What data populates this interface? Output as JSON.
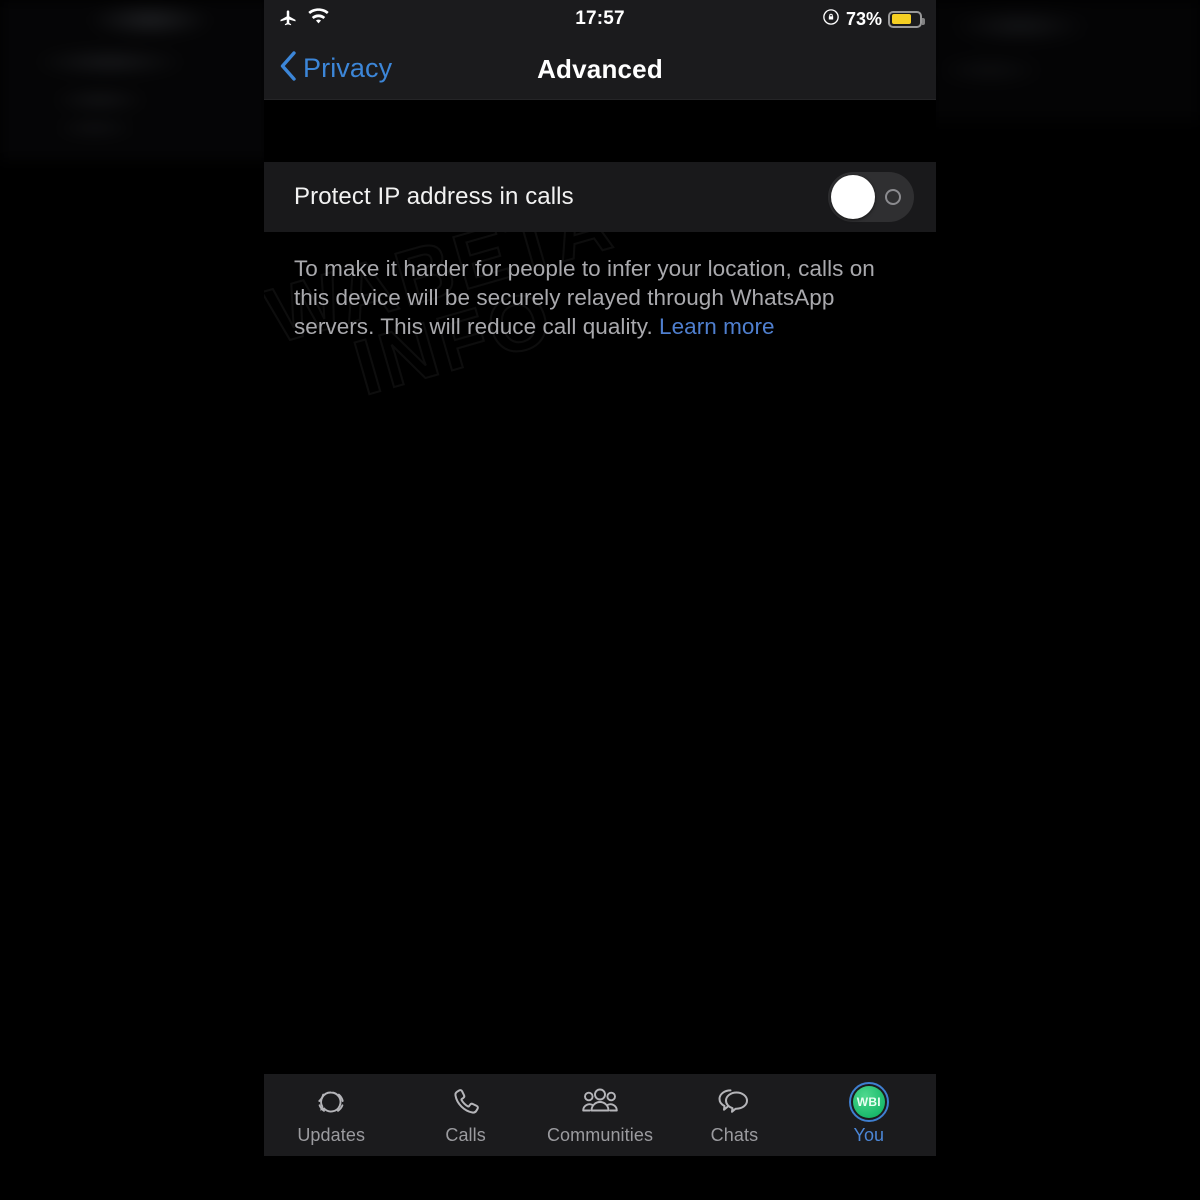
{
  "status_bar": {
    "airplane_icon": "airplane-mode-icon",
    "wifi_icon": "wifi-icon",
    "clock": "17:57",
    "rotation_lock_icon": "rotation-lock-icon",
    "battery_percent": "73%",
    "battery_level": 73,
    "battery_color": "#f5cf23"
  },
  "nav": {
    "back_label": "Privacy",
    "back_icon": "chevron-left-icon",
    "title": "Advanced",
    "accent_color": "#3c86d8"
  },
  "setting": {
    "label": "Protect IP address in calls",
    "toggle_state": "off",
    "toggle_off_mark": "O"
  },
  "description": {
    "text": "To make it harder for people to infer your location, calls on this device will be securely relayed through WhatsApp servers. This will reduce call quality. ",
    "link_text": "Learn more",
    "link_color": "#4f7fcf"
  },
  "watermark": {
    "line1": "WABETA",
    "line2": "INFO"
  },
  "tab_bar": {
    "tabs": [
      {
        "label": "Updates",
        "icon": "updates-status-icon",
        "active": false
      },
      {
        "label": "Calls",
        "icon": "phone-icon",
        "active": false
      },
      {
        "label": "Communities",
        "icon": "communities-group-icon",
        "active": false
      },
      {
        "label": "Chats",
        "icon": "chat-bubbles-icon",
        "active": false
      },
      {
        "label": "You",
        "icon": "profile-avatar-icon",
        "active": true,
        "avatar_text": "WBI",
        "avatar_color": "#18b86a"
      }
    ]
  }
}
